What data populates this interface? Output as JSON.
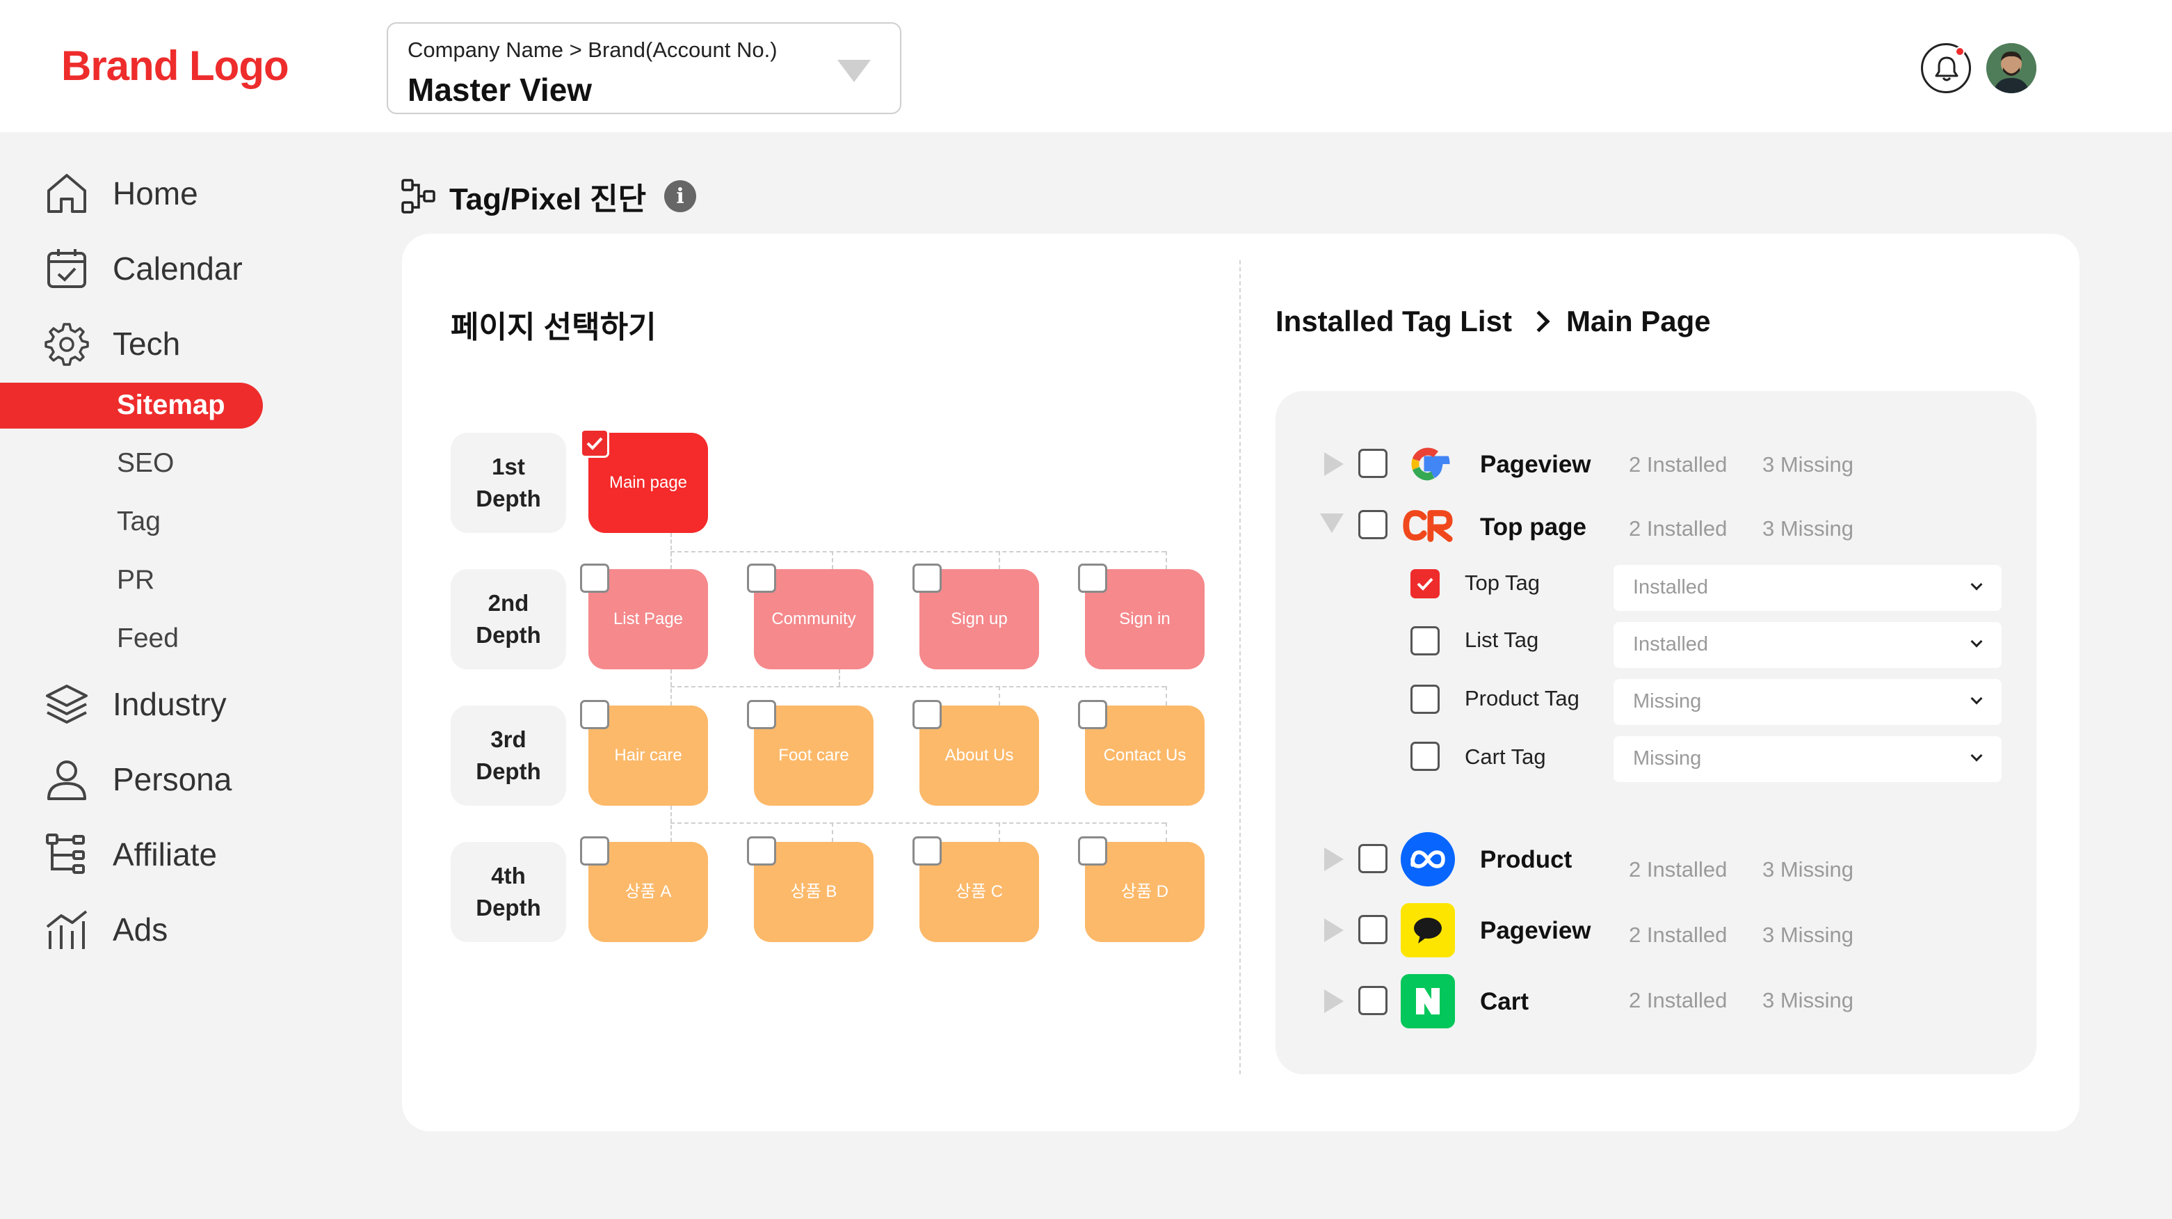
{
  "header": {
    "brand_logo": "Brand Logo",
    "account_path": "Company Name > Brand(Account No.)",
    "account_view": "Master View"
  },
  "sidebar": {
    "items": [
      {
        "label": "Home",
        "icon": "home-icon"
      },
      {
        "label": "Calendar",
        "icon": "calendar-icon"
      },
      {
        "label": "Tech",
        "icon": "gear-icon"
      },
      {
        "label": "Industry",
        "icon": "layers-icon"
      },
      {
        "label": "Persona",
        "icon": "person-icon"
      },
      {
        "label": "Affiliate",
        "icon": "tree-icon"
      },
      {
        "label": "Ads",
        "icon": "ads-icon"
      }
    ],
    "tech_sub": [
      "Sitemap",
      "SEO",
      "Tag",
      "PR",
      "Feed"
    ],
    "active_sub": "Sitemap"
  },
  "page": {
    "title": "Tag/Pixel 진단",
    "info_icon": "i"
  },
  "sitemap": {
    "section_title": "페이지 선택하기",
    "depths": [
      {
        "line1": "1st",
        "line2": "Depth"
      },
      {
        "line1": "2nd",
        "line2": "Depth"
      },
      {
        "line1": "3rd",
        "line2": "Depth"
      },
      {
        "line1": "4th",
        "line2": "Depth"
      }
    ],
    "nodes": {
      "main": {
        "label": "Main page",
        "checked": true
      },
      "depth2": [
        "List Page",
        "Community",
        "Sign up",
        "Sign in"
      ],
      "depth3": [
        "Hair care",
        "Foot care",
        "About Us",
        "Contact Us"
      ],
      "depth4": [
        "상품 A",
        "상품 B",
        "상품 C",
        "상품 D"
      ]
    },
    "colors": {
      "depth1": "#f52a2a",
      "depth2": "#f5898c",
      "depth3": "#fcb96a",
      "depth4": "#fcb96a"
    }
  },
  "tags": {
    "breadcrumb_root": "Installed Tag List",
    "breadcrumb_page": "Main Page",
    "rows": [
      {
        "vendor": "google",
        "name": "Pageview",
        "installed": "2 Installed",
        "missing": "3 Missing",
        "expanded": false
      },
      {
        "vendor": "criteo",
        "name": "Top page",
        "installed": "2 Installed",
        "missing": "3 Missing",
        "expanded": true
      },
      {
        "vendor": "meta",
        "name": "Product",
        "installed": "2 Installed",
        "missing": "3 Missing",
        "expanded": false
      },
      {
        "vendor": "kakao",
        "name": "Pageview",
        "installed": "2 Installed",
        "missing": "3 Missing",
        "expanded": false
      },
      {
        "vendor": "naver",
        "name": "Cart",
        "installed": "2 Installed",
        "missing": "3 Missing",
        "expanded": false
      }
    ],
    "sub_tags": [
      {
        "name": "Top Tag",
        "status": "Installed",
        "checked": true
      },
      {
        "name": "List Tag",
        "status": "Installed",
        "checked": false
      },
      {
        "name": "Product Tag",
        "status": "Missing",
        "checked": false
      },
      {
        "name": "Cart Tag",
        "status": "Missing",
        "checked": false
      }
    ]
  },
  "colors": {
    "accent": "#ee2c2c",
    "background": "#f3f3f3"
  }
}
